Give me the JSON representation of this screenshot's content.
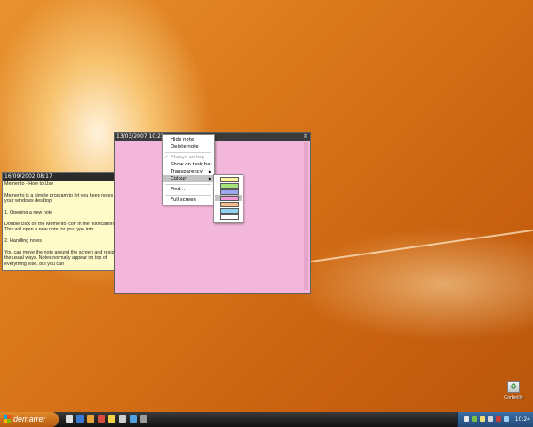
{
  "yellow_note": {
    "title": "16/09/2002 08:17",
    "body": "Memento - How to Use\n\nMemento is a simple program to let you keep notes on your windows desktop.\n\n1. Opening a new note\n\nDouble click on the Memento icon in the notification area.  This will open a new note for you type into.\n\n2. Handling notes\n\nYou can move the note around the screen and resize it in the usual ways.  Notes normally appear on top of everything else, but you can",
    "color": "#fffbc8"
  },
  "pink_note": {
    "title": "13/03/2007 10:22",
    "close_glyph": "×",
    "color": "#f3b7db"
  },
  "context_menu": {
    "items": [
      {
        "label": "Hide note"
      },
      {
        "label": "Delete note"
      },
      {
        "label": "Always on top",
        "checked": true,
        "disabled": true,
        "check_glyph": "✔"
      },
      {
        "label": "Show on task bar"
      },
      {
        "label": "Transparency",
        "submenu": true,
        "arrow_glyph": "▶"
      },
      {
        "label": "Colour",
        "submenu": true,
        "selected": true,
        "arrow_glyph": "▶"
      },
      {
        "label": "Find..."
      },
      {
        "label": "Full screen"
      }
    ]
  },
  "colour_menu": {
    "swatches": [
      {
        "color": "#fff59d"
      },
      {
        "color": "#a6e37a"
      },
      {
        "color": "#9fa8ef"
      },
      {
        "color": "#f39bd8",
        "selected": true
      },
      {
        "color": "#f6bb8a"
      },
      {
        "color": "#8fd3f2"
      },
      {
        "color": "#ffffff"
      }
    ]
  },
  "taskbar": {
    "start_label": "demarrer",
    "clock": "10:24"
  },
  "desktop": {
    "recycle_label": "Corbeille",
    "recycle_glyph": "♻"
  }
}
